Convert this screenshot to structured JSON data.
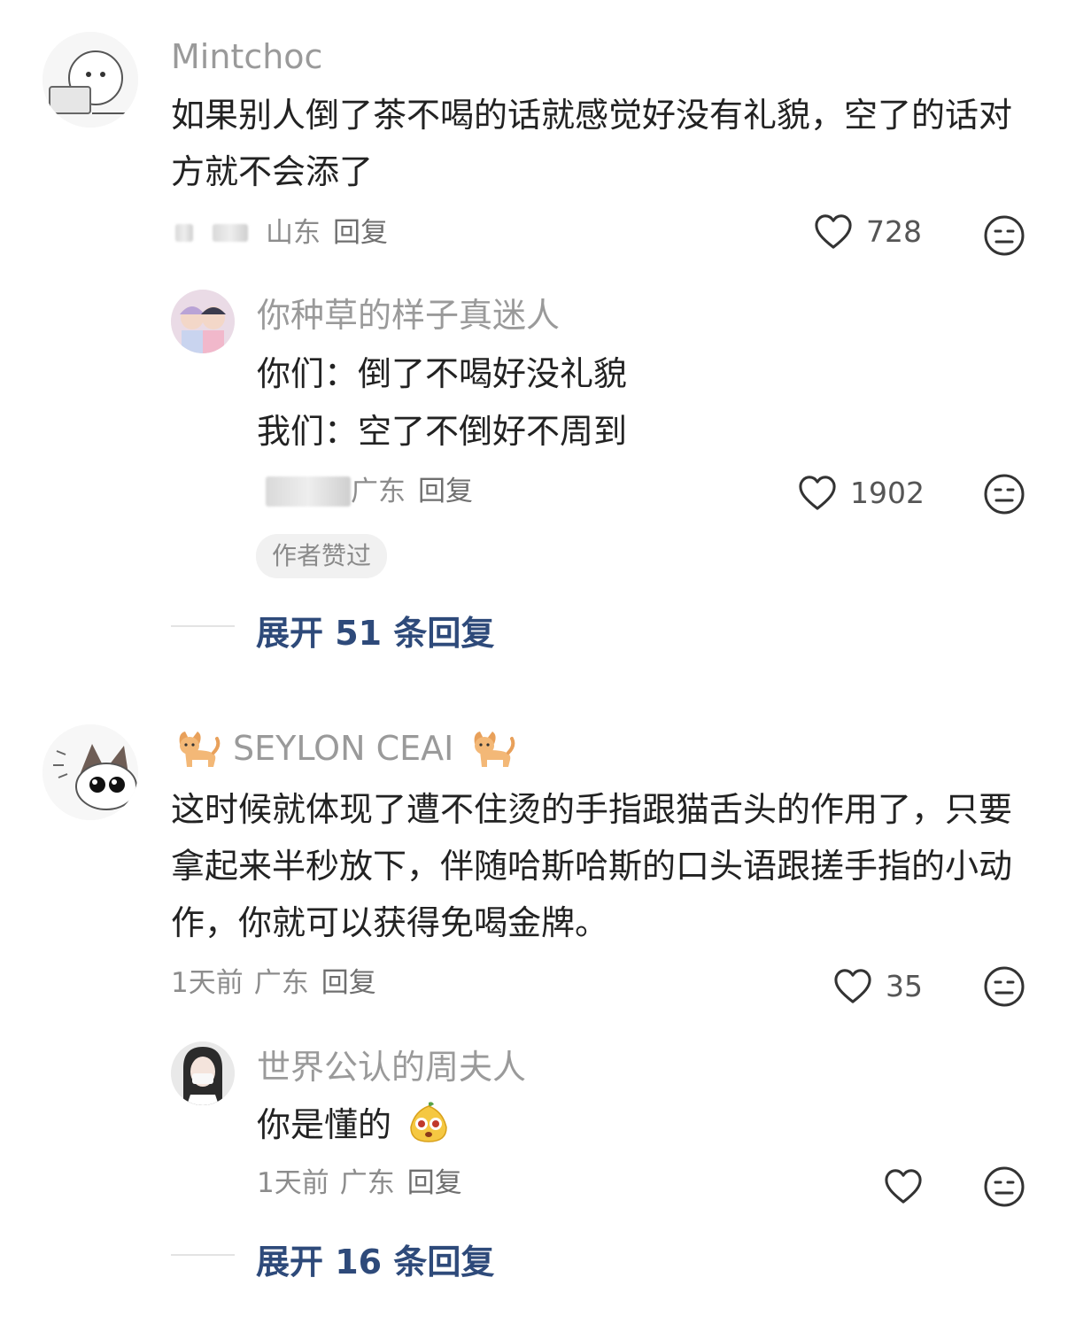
{
  "comments": [
    {
      "username": "Mintchoc",
      "content": "如果别人倒了茶不喝的话就感觉好没有礼貌，空了的话对方就不会添了",
      "location": "山东",
      "reply_label": "回复",
      "likes": "728",
      "replies": [
        {
          "username": "你种草的样子真迷人",
          "line1": "你们：倒了不喝好没礼貌",
          "line2": "我们：空了不倒好不周到",
          "location": "广东",
          "reply_label": "回复",
          "likes": "1902",
          "badge": "作者赞过"
        }
      ],
      "expand_label": "展开 51 条回复"
    },
    {
      "username": "SEYLON CEAI",
      "content": "这时候就体现了遭不住烫的手指跟猫舌头的作用了，只要拿起来半秒放下，伴随哈斯哈斯的口头语跟搓手指的小动作，你就可以获得免喝金牌。",
      "time": "1天前",
      "location": "广东",
      "reply_label": "回复",
      "likes": "35",
      "replies": [
        {
          "username": "世界公认的周夫人",
          "content": "你是懂的",
          "time": "1天前",
          "location": "广东",
          "reply_label": "回复"
        }
      ],
      "expand_label": "展开 16 条回复"
    }
  ],
  "icons": {
    "like": "heart-outline-icon",
    "dislike": "meh-face-icon",
    "cat": "cat-emoji-icon",
    "inline_emoji": "shocked-pear-emoji-icon"
  },
  "colors": {
    "text_primary": "#222222",
    "text_secondary": "#9a9a9a",
    "expand_link": "#2e4a7a",
    "icon": "#333333"
  }
}
